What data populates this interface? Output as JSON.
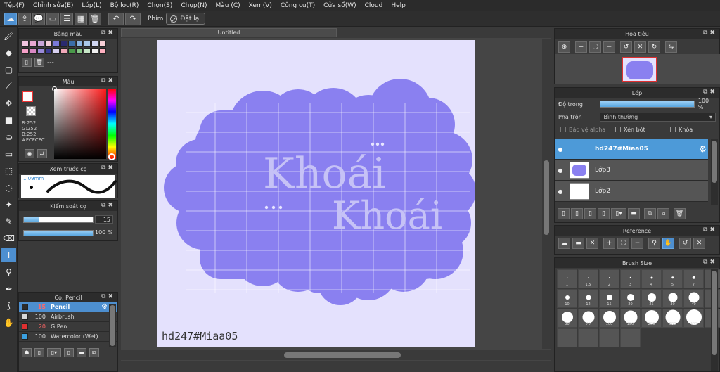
{
  "menubar": [
    "Tệp(F)",
    "Chỉnh sửa(E)",
    "Lớp(L)",
    "Bộ lọc(R)",
    "Chọn(S)",
    "Chụp(N)",
    "Màu (C)",
    "Xem(V)",
    "Công cụ(T)",
    "Cửa sổ(W)",
    "Cloud",
    "Help"
  ],
  "toolbar": {
    "keys_label": "Phím",
    "reset_label": "Đặt lại"
  },
  "palette": {
    "title": "Bảng màu",
    "swatches": [
      "#f2c6e0",
      "#e8a8d2",
      "#c9a5d8",
      "#f3cdd8",
      "#7a7ad8",
      "#2a2a6e",
      "#3b6ea8",
      "#8bb4e0",
      "#aac8e8",
      "#d0d6f2",
      "#f8d0d8",
      "#f6a0c8",
      "#d988c4",
      "#9a8ad8",
      "#3a3a90",
      "#d8d0f0",
      "#f0a8b8",
      "#4a9a4a",
      "#88c888",
      "#c8e8c8",
      "#f0f0f0",
      "#ffb0c0"
    ],
    "name_text": "---"
  },
  "color": {
    "title": "Màu",
    "r": "R:252",
    "g": "G:252",
    "b": "B:252",
    "hex": "#FCFCFC",
    "foreground": "#fcfcfc"
  },
  "brush_preview": {
    "title": "Xem trước cọ",
    "size_label": "1.09mm"
  },
  "brush_control": {
    "title": "Kiểm soát cọ",
    "size_value": "15",
    "opacity_value": "100 %",
    "size_fraction": 0.22,
    "opacity_fraction": 1.0
  },
  "brush_list": {
    "title": "Cọ: Pencil",
    "items": [
      {
        "size": "15",
        "name": "Pencil",
        "color": "#2b2b2b",
        "selected": true
      },
      {
        "size": "100",
        "name": "Airbrush",
        "color": "#d8d8d8",
        "selected": false
      },
      {
        "size": "20",
        "name": "G Pen",
        "color": "#e03030",
        "selected": false
      },
      {
        "size": "100",
        "name": "Watercolor (Wet)",
        "color": "#3aa0e0",
        "selected": false
      }
    ]
  },
  "document": {
    "tab_title": "Untitled",
    "watermark": "hd247#Miaa05",
    "blob_color": "#8a80f0",
    "text_color": "#c6c2f6"
  },
  "artwork": {
    "line1": "Khoái",
    "line2": "Khoái"
  },
  "navigator": {
    "title": "Hoa tiêu"
  },
  "layers": {
    "title": "Lớp",
    "opacity_label": "Độ trong",
    "opacity_value": "100 %",
    "blend_label": "Pha trộn",
    "blend_value": "Bình thường",
    "protect_alpha": "Bảo vệ alpha",
    "clipping": "Xén bớt",
    "lock": "Khóa",
    "items": [
      {
        "name": "hd247#Miaa05",
        "selected": true
      },
      {
        "name": "Lớp3",
        "selected": false
      },
      {
        "name": "Lớp2",
        "selected": false
      }
    ]
  },
  "reference": {
    "title": "Reference"
  },
  "brush_size": {
    "title": "Brush Size",
    "cells": [
      "1",
      "1.5",
      "2",
      "3",
      "4",
      "5",
      "7",
      "",
      "10",
      "12",
      "15",
      "20",
      "25",
      "30",
      "40",
      "",
      "50",
      "70",
      "100",
      "150",
      "200",
      "300",
      "400",
      "",
      "",
      "",
      "",
      ""
    ]
  }
}
